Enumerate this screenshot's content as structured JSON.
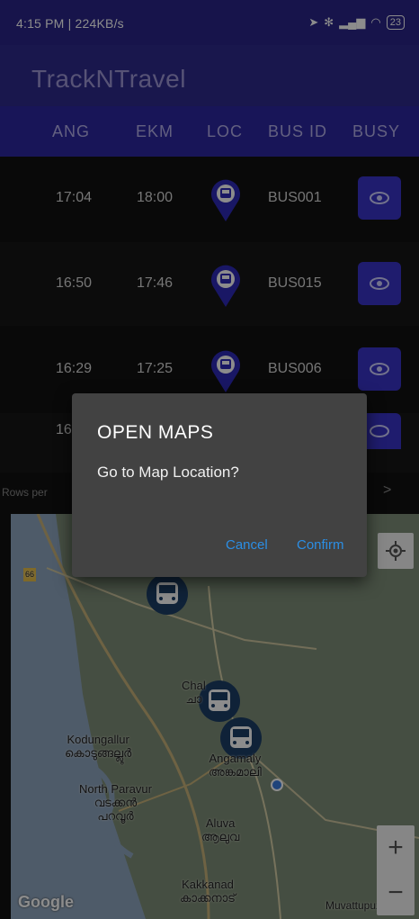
{
  "status_bar": {
    "time_speed": "4:15 PM | 224KB/s",
    "battery": "23"
  },
  "app": {
    "title": "TrackNTravel"
  },
  "table": {
    "headers": [
      "ANG",
      "EKM",
      "LOC",
      "BUS ID",
      "BUSY"
    ],
    "rows": [
      {
        "ang": "17:04",
        "ekm": "18:00",
        "bus_id": "BUS001"
      },
      {
        "ang": "16:50",
        "ekm": "17:46",
        "bus_id": "BUS015"
      },
      {
        "ang": "16:29",
        "ekm": "17:25",
        "bus_id": "BUS006"
      },
      {
        "ang": "16:",
        "ekm": "",
        "bus_id": ""
      }
    ],
    "rows_per_page_label": "Rows per",
    "next_page_glyph": ">"
  },
  "dialog": {
    "title": "OPEN MAPS",
    "message": "Go to Map Location?",
    "cancel": "Cancel",
    "confirm": "Confirm"
  },
  "map": {
    "labels": {
      "route": "66",
      "chal": "Chal",
      "chal_ml": "ചാ",
      "kodungallur": "Kodungallur",
      "kodungallur_ml": "കൊടുങ്ങല്ലൂർ",
      "angamaly": "Angamaly",
      "angamaly_ml": "അങ്കമാലി",
      "north_paravur": "North Paravur",
      "north_paravur_ml1": "വടക്കൻ",
      "north_paravur_ml2": "പറവൂർ",
      "aluva": "Aluva",
      "aluva_ml": "ആലുവ",
      "kakkanad": "Kakkanad",
      "kakkanad_ml": "കാക്കനാട്",
      "muvattupuzha": "Muvattupuzha",
      "google": "Google",
      "zoom_in": "+",
      "zoom_out": "−"
    }
  },
  "colors": {
    "appbar": "#2f2a8c",
    "header": "#2c27a0",
    "button": "#3a34c8",
    "accent_link": "#2b8ee5"
  }
}
